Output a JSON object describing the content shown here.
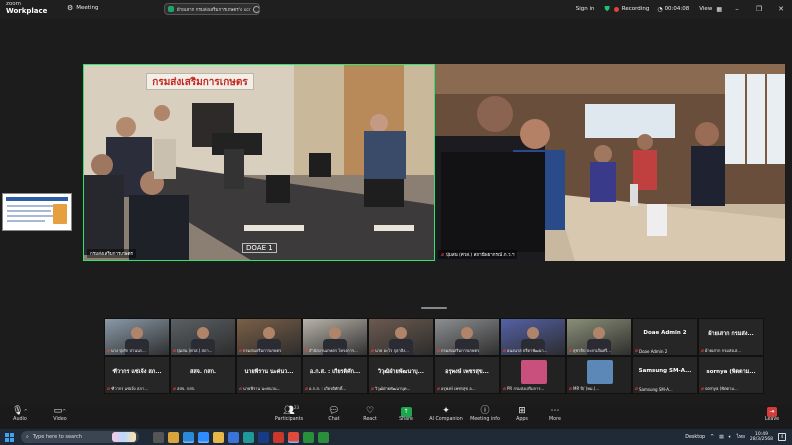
{
  "app": {
    "brand_top": "zoom",
    "brand_bottom": "Workplace"
  },
  "titlebar": {
    "meeting_label": "Meeting",
    "share_pill_text": "ผ้ายเสาก กรมส่งเสริมการเกษตร's scr",
    "signin": "Sign in",
    "recording": "Recording",
    "timer": "00:04:08",
    "view": "View"
  },
  "main": {
    "left_video": {
      "name": "กรมส่งเสริมการเกษตร",
      "sign_text": "กรมส่งเสริมการเกษตร",
      "doae_label": "DOAE 1",
      "mic_muted": false
    },
    "right_video": {
      "name": "ปุ่มสน (ศวส.) สถานีพยากรณ์ ภ.ว.ฯ",
      "mic_muted": true
    }
  },
  "gallery": [
    {
      "top": "",
      "label": "นาง ปุ่งรัก ปานนร...",
      "muted": true,
      "kind": "image",
      "hue": "#8a9aa8"
    },
    {
      "top": "",
      "label": "ปุ่มสน (ศวส.) สถา...",
      "muted": true,
      "kind": "image",
      "hue": "#5b6064"
    },
    {
      "top": "",
      "label": "กรมส่งเสริมการเกษตร",
      "muted": true,
      "kind": "image",
      "hue": "#7a6048"
    },
    {
      "top": "",
      "label": "สำนักงานเกษตร โครงการ...",
      "muted": true,
      "kind": "image",
      "hue": "#b8b3aa"
    },
    {
      "top": "",
      "label": "นาย อะไร กุลาสิง...",
      "muted": true,
      "kind": "image",
      "hue": "#6b5a50"
    },
    {
      "top": "",
      "label": "กรมส่งเสริมการเกษตร",
      "muted": true,
      "kind": "image",
      "hue": "#8d8e90"
    },
    {
      "top": "",
      "label": "อนงนาส ปรีดาพัฒนา...",
      "muted": true,
      "kind": "image",
      "hue": "#5561a6"
    },
    {
      "top": "",
      "label": "สุชาธิป ปะยาเส้นศรี...",
      "muted": true,
      "kind": "image",
      "hue": "#8a8f78"
    },
    {
      "top": "Doae Admin 2",
      "label": "Doae Admin 2",
      "muted": true,
      "kind": "name"
    },
    {
      "top": "ผ้ายเสาก กรมส่ง...",
      "label": "ผ้ายเสาก กรมส่งเส...",
      "muted": true,
      "kind": "name"
    },
    {
      "top": "ฑีวากร แซ่เจ้ง สภ...",
      "label": "ฑีวากร แซ่เจ้ง สภา...",
      "muted": true,
      "kind": "name"
    },
    {
      "top": "สสจ. กสก.",
      "label": "สสจ. กสก.",
      "muted": true,
      "kind": "name"
    },
    {
      "top": "นายพีราน นะค่นว...",
      "label": "นายพีราน นะค่นวน...",
      "muted": true,
      "kind": "name"
    },
    {
      "top": "อ.ก.ส. : เกียรติศัก...",
      "label": "อ.ก.ส. : เกียรติศักดิ์...",
      "muted": true,
      "kind": "name"
    },
    {
      "top": "วิวุฒิฝ่ายพัฒนาบุ...",
      "label": "วิวุฒิฝ่ายพัฒนาบุค...",
      "muted": true,
      "kind": "name"
    },
    {
      "top": "อรุพงษ์ เพชรสุข...",
      "label": "อรุพงษ์ เพชรสุข อ...",
      "muted": true,
      "kind": "name"
    },
    {
      "top": "",
      "label": "PR กรมส่งเสริมการ...",
      "muted": true,
      "kind": "avatar",
      "hue": "#c94f7c"
    },
    {
      "top": "",
      "label": "MR ปี/ (ทม.)...",
      "muted": true,
      "kind": "avatar",
      "hue": "#5c88b8"
    },
    {
      "top": "Samsung SM-A...",
      "label": "Samsung SM-A...",
      "muted": true,
      "kind": "name"
    },
    {
      "top": "sornya (พิตตาม...",
      "label": "sornya (พิตตาม...",
      "muted": true,
      "kind": "name"
    }
  ],
  "toolbar": {
    "audio": "Audio",
    "video": "Video",
    "participants": "Participants",
    "participants_count": "23",
    "chat": "Chat",
    "react": "React",
    "share": "Share",
    "ai_companion": "AI Companion",
    "meeting_info": "Meeting info",
    "apps": "Apps",
    "more": "More",
    "leave": "Leave"
  },
  "taskbar": {
    "search_placeholder": "Type here to search",
    "desktop": "Desktop",
    "lang": "ไทย",
    "time": "10:49",
    "date": "28/3/2568",
    "notif_count": "4"
  },
  "colors": {
    "active_speaker_border": "#2ee66b",
    "recording_red": "#e04040",
    "share_green": "#1ea64e",
    "leave_red": "#d53b3b",
    "taskbar": "#202a36"
  }
}
